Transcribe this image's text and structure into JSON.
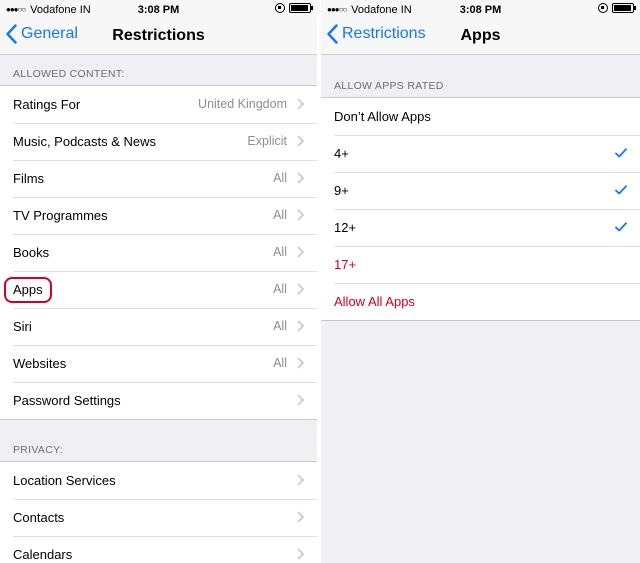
{
  "left": {
    "status": {
      "carrier": "Vodafone IN",
      "time": "3:08 PM"
    },
    "nav": {
      "back_label": "General",
      "title": "Restrictions"
    },
    "allowed_content_header": "ALLOWED CONTENT:",
    "allowed_content_items": [
      {
        "label": "Ratings For",
        "detail": "United Kingdom"
      },
      {
        "label": "Music, Podcasts & News",
        "detail": "Explicit"
      },
      {
        "label": "Films",
        "detail": "All"
      },
      {
        "label": "TV Programmes",
        "detail": "All"
      },
      {
        "label": "Books",
        "detail": "All"
      },
      {
        "label": "Apps",
        "detail": "All"
      },
      {
        "label": "Siri",
        "detail": "All"
      },
      {
        "label": "Websites",
        "detail": "All"
      },
      {
        "label": "Password Settings",
        "detail": ""
      }
    ],
    "privacy_header": "PRIVACY:",
    "privacy_items": [
      {
        "label": "Location Services"
      },
      {
        "label": "Contacts"
      },
      {
        "label": "Calendars"
      }
    ]
  },
  "right": {
    "status": {
      "carrier": "Vodafone IN",
      "time": "3:08 PM"
    },
    "nav": {
      "back_label": "Restrictions",
      "title": "Apps"
    },
    "section_header": "ALLOW APPS RATED",
    "items": [
      {
        "label": "Don’t Allow Apps",
        "checked": false
      },
      {
        "label": "4+",
        "checked": true
      },
      {
        "label": "9+",
        "checked": true
      },
      {
        "label": "12+",
        "checked": true
      },
      {
        "label": "17+",
        "checked": false
      },
      {
        "label": "Allow All Apps",
        "checked": false
      }
    ]
  },
  "colors": {
    "accent": "#1577f0",
    "highlight": "#d0021b",
    "restricted_text": "#d0021b"
  },
  "battery_level": 0.9
}
